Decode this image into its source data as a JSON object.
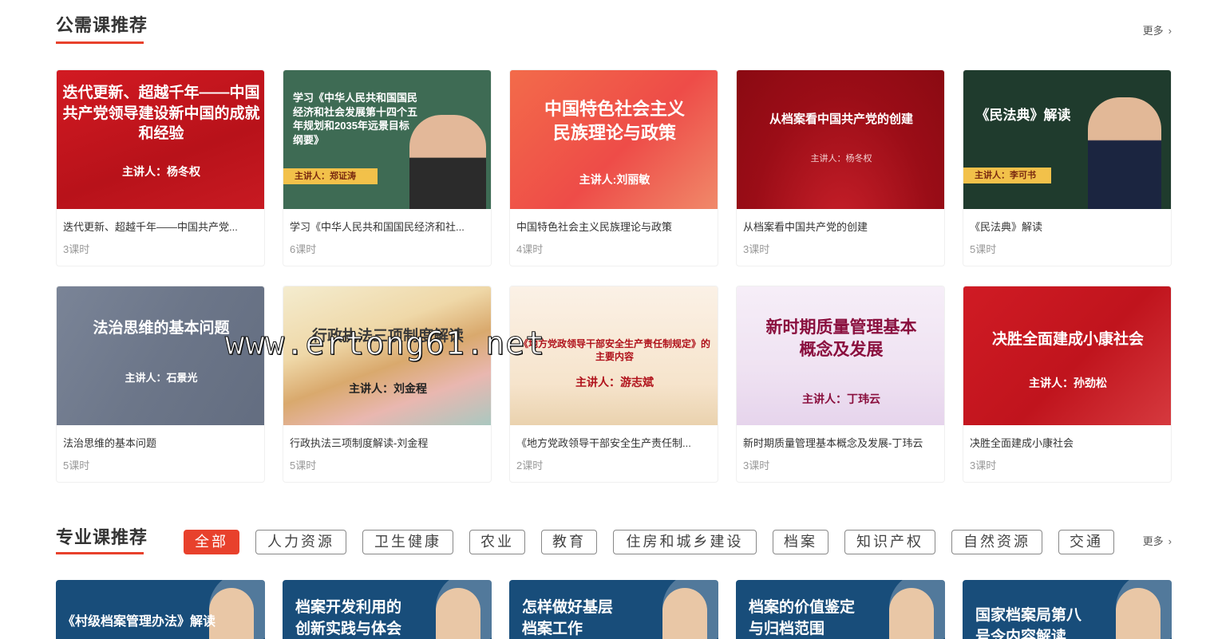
{
  "public_section": {
    "title": "公需课推荐",
    "more_label": "更多"
  },
  "public_courses": [
    {
      "name": "迭代更新、超越千年——中国共产党...",
      "hours": "3课时",
      "thumb_title": "迭代更新、超越千年——中国共产党领导建设新中国的成就和经验",
      "thumb_speaker": "主讲人：杨冬权",
      "bg": "#c8161d"
    },
    {
      "name": "学习《中华人民共和国国民经济和社...",
      "hours": "6课时",
      "thumb_title": "学习《中华人民共和国国民经济和社会发展第十四个五年规划和2035年远景目标纲要》",
      "thumb_speaker": "主讲人：郑证涛",
      "bg": "#3e6b54"
    },
    {
      "name": "中国特色社会主义民族理论与政策",
      "hours": "4课时",
      "thumb_title": "中国特色社会主义民族理论与政策",
      "thumb_speaker": "主讲人:刘丽敏",
      "bg": "#f0564a"
    },
    {
      "name": "从档案看中国共产党的创建",
      "hours": "3课时",
      "thumb_title": "从档案看中国共产党的创建",
      "thumb_speaker": "主讲人：杨冬权",
      "bg": "#a3101a"
    },
    {
      "name": "《民法典》解读",
      "hours": "5课时",
      "thumb_title": "《民法典》解读",
      "thumb_speaker": "主讲人：李可书",
      "bg": "#1e3a2c"
    },
    {
      "name": "法治思维的基本问题",
      "hours": "5课时",
      "thumb_title": "法治思维的基本问题",
      "thumb_speaker": "主讲人：石景光",
      "bg": "#6f7a8e"
    },
    {
      "name": "行政执法三项制度解读-刘金程",
      "hours": "5课时",
      "thumb_title": "行政执法三项制度解读",
      "thumb_speaker": "主讲人：刘金程",
      "bg": "#efe3c4"
    },
    {
      "name": "《地方党政领导干部安全生产责任制...",
      "hours": "2课时",
      "thumb_title": "《地方党政领导干部安全生产责任制规定》的主要内容",
      "thumb_speaker": "主讲人：游志斌",
      "bg": "#f7e8d5"
    },
    {
      "name": "新时期质量管理基本概念及发展-丁玮云",
      "hours": "3课时",
      "thumb_title": "新时期质量管理基本概念及发展",
      "thumb_speaker": "主讲人：丁玮云",
      "bg": "#f1e6f3"
    },
    {
      "name": "决胜全面建成小康社会",
      "hours": "3课时",
      "thumb_title": "决胜全面建成小康社会",
      "thumb_speaker": "主讲人：孙劲松",
      "bg": "#c9161f"
    }
  ],
  "pro_section": {
    "title": "专业课推荐",
    "more_label": "更多",
    "tabs": [
      "全部",
      "人力资源",
      "卫生健康",
      "农业",
      "教育",
      "住房和城乡建设",
      "档案",
      "知识产权",
      "自然资源",
      "交通"
    ]
  },
  "pro_courses": [
    {
      "thumb_title": "《村级档案管理办法》解读"
    },
    {
      "thumb_title": "档案开发利用的创新实践与体会"
    },
    {
      "thumb_title": "怎样做好基层档案工作"
    },
    {
      "thumb_title": "档案的价值鉴定与归档范围"
    },
    {
      "thumb_title": "国家档案局第八号令内容解读"
    }
  ],
  "watermark": "www.ertong61.net",
  "colors": {
    "accent": "#e8412c",
    "pro_card_bg": "#184d7a"
  }
}
